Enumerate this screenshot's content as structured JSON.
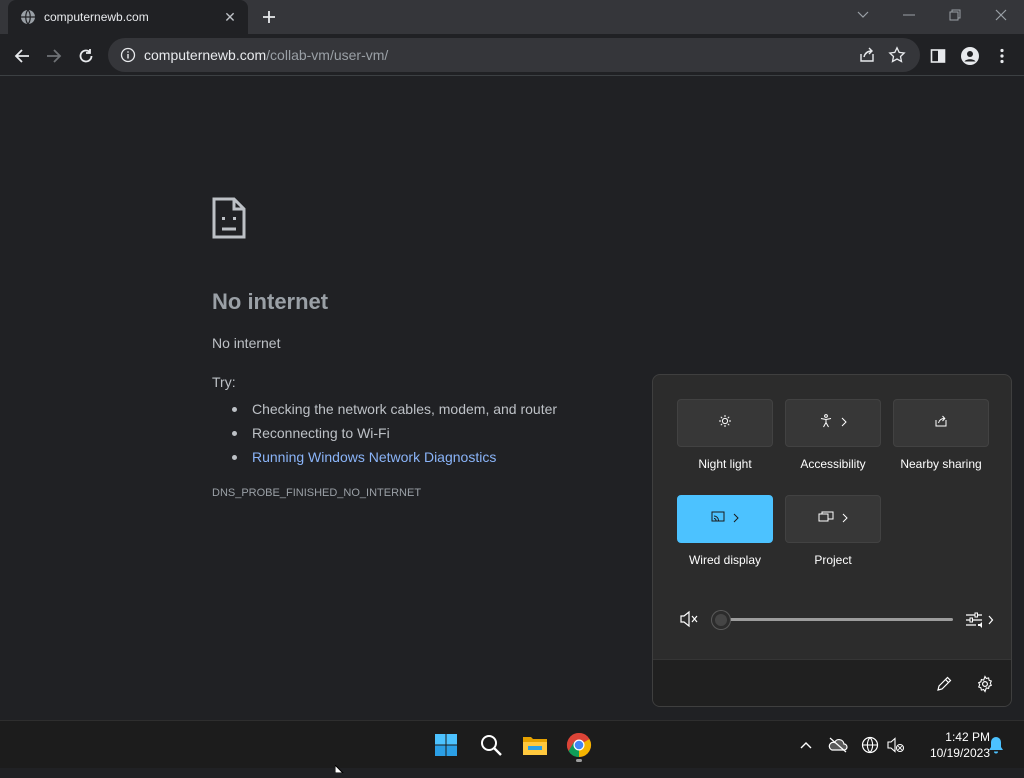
{
  "browser": {
    "tab_title": "computernewb.com",
    "url_host": "computernewb.com",
    "url_path": "/collab-vm/user-vm/"
  },
  "error_page": {
    "heading": "No internet",
    "subheading": "No internet",
    "try_label": "Try:",
    "suggestions": [
      "Checking the network cables, modem, and router",
      "Reconnecting to Wi-Fi",
      "Running Windows Network Diagnostics"
    ],
    "error_code": "DNS_PROBE_FINISHED_NO_INTERNET"
  },
  "quick_settings": {
    "tiles": [
      {
        "label": "Night light",
        "icon": "brightness-icon",
        "active": false
      },
      {
        "label": "Accessibility",
        "icon": "accessibility-icon",
        "active": false
      },
      {
        "label": "Nearby sharing",
        "icon": "share-icon",
        "active": false
      },
      {
        "label": "Wired display",
        "icon": "cast-icon",
        "active": true
      },
      {
        "label": "Project",
        "icon": "project-icon",
        "active": false
      }
    ],
    "volume_level": 0,
    "volume_muted": true,
    "accent": "#4cc2ff"
  },
  "taskbar": {
    "time": "1:42 PM",
    "date": "10/19/2023"
  }
}
